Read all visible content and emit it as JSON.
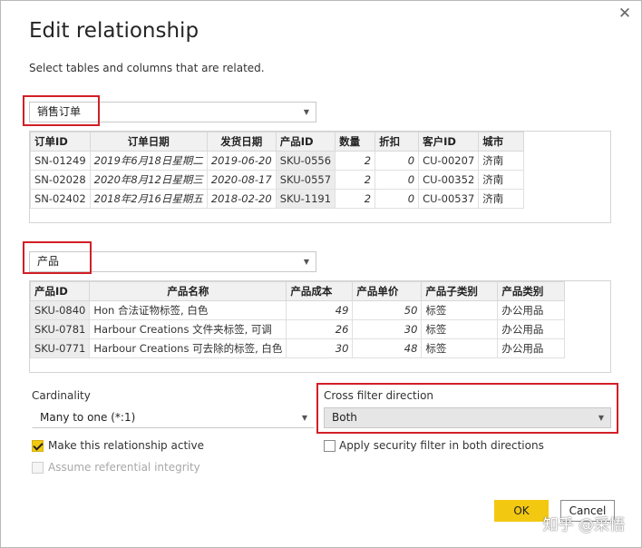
{
  "dialog": {
    "title": "Edit relationship",
    "subtitle": "Select tables and columns that are related.",
    "close_glyph": "✕"
  },
  "table1": {
    "selected": "销售订单",
    "headers": [
      "订单ID",
      "订单日期",
      "发货日期",
      "产品ID",
      "数量",
      "折扣",
      "客户ID",
      "城市"
    ],
    "rows": [
      [
        "SN-01249",
        "2019年6月18日星期二",
        "2019-06-20",
        "SKU-0556",
        "2",
        "0",
        "CU-00207",
        "济南"
      ],
      [
        "SN-02028",
        "2020年8月12日星期三",
        "2020-08-17",
        "SKU-0557",
        "2",
        "0",
        "CU-00352",
        "济南"
      ],
      [
        "SN-02402",
        "2018年2月16日星期五",
        "2018-02-20",
        "SKU-1191",
        "2",
        "0",
        "CU-00537",
        "济南"
      ]
    ]
  },
  "table2": {
    "selected": "产品",
    "headers": [
      "产品ID",
      "产品名称",
      "产品成本",
      "产品单价",
      "产品子类别",
      "产品类别"
    ],
    "rows": [
      [
        "SKU-0840",
        "Hon 合法证物标签, 白色",
        "49",
        "50",
        "标签",
        "办公用品"
      ],
      [
        "SKU-0781",
        "Harbour Creations 文件夹标签, 可调",
        "26",
        "30",
        "标签",
        "办公用品"
      ],
      [
        "SKU-0771",
        "Harbour Creations 可去除的标签, 白色",
        "30",
        "48",
        "标签",
        "办公用品"
      ]
    ]
  },
  "cardinality": {
    "label": "Cardinality",
    "value": "Many to one (*:1)"
  },
  "cross_filter": {
    "label": "Cross filter direction",
    "value": "Both"
  },
  "options": {
    "active_label": "Make this relationship active",
    "active_checked": true,
    "security_label": "Apply security filter in both directions",
    "security_checked": false,
    "integrity_label": "Assume referential integrity",
    "integrity_checked": false
  },
  "buttons": {
    "ok": "OK",
    "cancel": "Cancel"
  },
  "watermark": "知乎 @采悟",
  "colors": {
    "accent": "#f2c811",
    "highlight_red": "#d21f26",
    "header_bg": "#f1f1f1"
  }
}
